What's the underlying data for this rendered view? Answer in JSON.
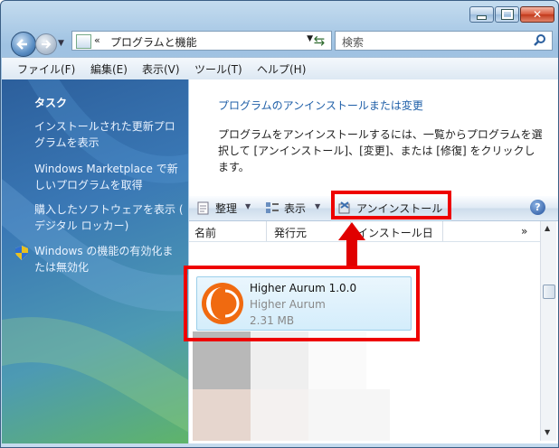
{
  "nav": {
    "back_label": "",
    "address_prefix": "«",
    "address": "プログラムと機能",
    "search_placeholder": "検索"
  },
  "menu": [
    "ファイル(F)",
    "編集(E)",
    "表示(V)",
    "ツール(T)",
    "ヘルプ(H)"
  ],
  "sidebar": {
    "title": "タスク",
    "links": [
      "インストールされた更新プログラムを表示",
      "Windows Marketplace で新しいプログラムを取得",
      "購入したソフトウェアを表示 ( デジタル ロッカー)",
      "Windows の機能の有効化または無効化"
    ]
  },
  "content": {
    "heading": "プログラムのアンインストールまたは変更",
    "description": "プログラムをアンインストールするには、一覧からプログラムを選択して [アンインストール]、[変更]、または [修復] をクリックします。"
  },
  "toolbar": {
    "organize": "整理",
    "view": "表示",
    "uninstall": "アンインストール",
    "help": "?"
  },
  "columns": {
    "name": "名前",
    "publisher": "発行元",
    "installed": "インストール日",
    "more": "»"
  },
  "program": {
    "name": "Higher Aurum 1.0.0",
    "publisher": "Higher Aurum",
    "size": "2.31 MB"
  },
  "colors": {
    "annotation": "#e00000",
    "logo_orange": "#f06a10",
    "link": "#1f5fa8"
  }
}
